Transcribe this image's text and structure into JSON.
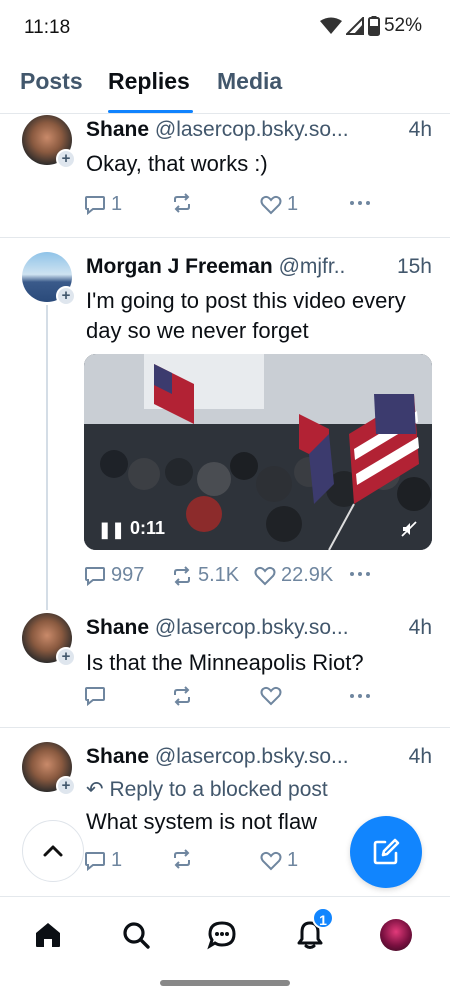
{
  "status": {
    "time": "11:18",
    "battery": "52%"
  },
  "tabs": [
    {
      "label": "Posts"
    },
    {
      "label": "Replies"
    },
    {
      "label": "Media"
    }
  ],
  "active_tab": "Replies",
  "posts": [
    {
      "author": "Shane",
      "handle": "@lasercop.bsky.so...",
      "time": "4h",
      "text": "Okay, that works :)",
      "replies": "1",
      "reposts": "",
      "likes": "1"
    },
    {
      "author": "Morgan J Freeman",
      "handle": "@mjfr..",
      "time": "15h",
      "text": "I'm going to post this video every day so we never forget",
      "video_time": "0:11",
      "replies": "997",
      "reposts": "5.1K",
      "likes": "22.9K"
    },
    {
      "author": "Shane",
      "handle": "@lasercop.bsky.so...",
      "time": "4h",
      "text": "Is that the Minneapolis Riot?",
      "replies": "",
      "reposts": "",
      "likes": ""
    },
    {
      "author": "Shane",
      "handle": "@lasercop.bsky.so...",
      "time": "4h",
      "reply_note": "Reply to a blocked post",
      "text": "What system is not flaw",
      "replies": "1",
      "reposts": "",
      "likes": "1"
    }
  ],
  "nav": {
    "notifications_badge": "1"
  },
  "colors": {
    "accent": "#1185fe",
    "muted": "#42576c"
  },
  "icons": [
    "wifi-icon",
    "signal-icon",
    "battery-icon",
    "reply-icon",
    "repost-icon",
    "like-icon",
    "more-icon",
    "pause-icon",
    "mute-icon",
    "chevron-up-icon",
    "compose-icon",
    "home-icon",
    "search-icon",
    "chat-icon",
    "bell-icon"
  ]
}
